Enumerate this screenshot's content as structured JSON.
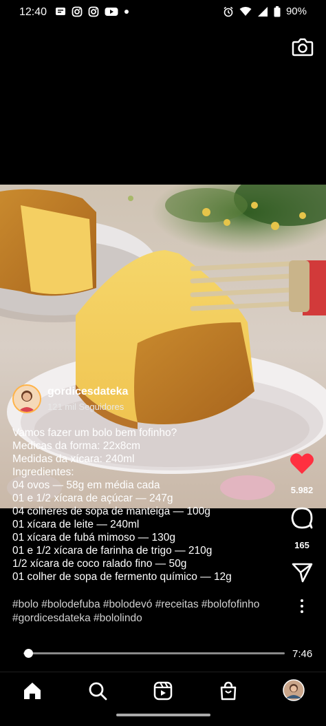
{
  "status_bar": {
    "time": "12:40",
    "battery": "90%",
    "left_icons": [
      "notification-icon",
      "instagram-icon",
      "instagram-icon",
      "youtube-icon",
      "dot-icon"
    ],
    "right_icons": [
      "alarm-icon",
      "wifi-icon",
      "signal-icon",
      "battery-icon"
    ]
  },
  "author": {
    "name": "gordicesdateka",
    "followers": "121 mil Seguidores"
  },
  "caption": {
    "lines": [
      "Vamos fazer um bolo bem fofinho?",
      "Medicas da forma: 22x8cm",
      "Medidas da xícara: 240ml",
      "Ingredientes:",
      "04 ovos — 58g em média cada",
      "01 e 1/2 xícara de açúcar — 247g",
      "04 colheres de sopa de manteiga — 100g",
      "01 xícara de leite — 240ml",
      "01 xícara de fubá mimoso — 130g",
      "01 e 1/2 xícara de farinha de trigo — 210g",
      "1/2 xícara de coco ralado fino — 50g",
      "01 colher de sopa de fermento químico — 12g"
    ],
    "hashtags_line1": "#bolo #bolodefuba #bolodevó #receitas #bolofofinho",
    "hashtags_line2": "#gordicesdateka #bololindo"
  },
  "actions": {
    "likes": "5.982",
    "comments": "165",
    "like_color": "#ff3040"
  },
  "player": {
    "duration": "7:46",
    "progress_fraction": 0.02
  },
  "nav": {
    "items": [
      "home-icon",
      "search-icon",
      "reels-icon",
      "shop-icon",
      "profile-avatar"
    ]
  }
}
